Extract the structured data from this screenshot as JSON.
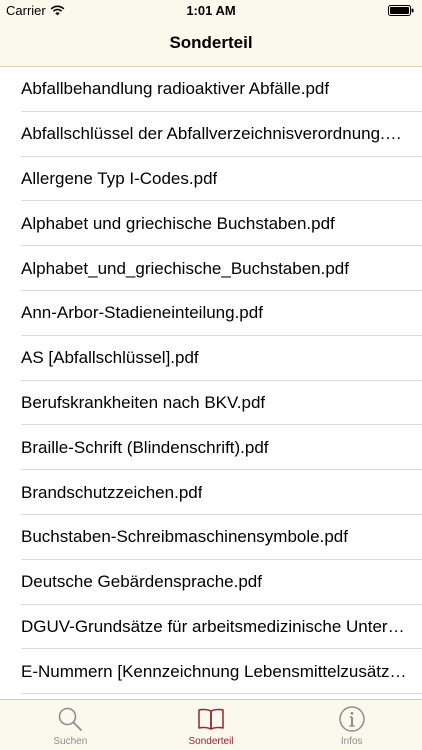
{
  "status_bar": {
    "carrier": "Carrier",
    "time": "1:01 AM"
  },
  "nav": {
    "title": "Sonderteil"
  },
  "list": {
    "items": [
      "Abfallbehandlung radioaktiver Abfälle.pdf",
      "Abfallschlüssel der Abfallverzeichnisverordnung.pdf",
      "Allergene Typ I-Codes.pdf",
      "Alphabet und griechische Buchstaben.pdf",
      "Alphabet_und_griechische_Buchstaben.pdf",
      "Ann-Arbor-Stadieneinteilung.pdf",
      "AS [Abfallschlüssel].pdf",
      "Berufskrankheiten nach BKV.pdf",
      "Braille-Schrift (Blindenschrift).pdf",
      "Brandschutzzeichen.pdf",
      "Buchstaben-Schreibmaschinensymbole.pdf",
      "Deutsche Gebärdensprache.pdf",
      "DGUV-Grundsätze für arbeitsmedizinische Untersuchungen.pdf",
      "E-Nummern [Kennzeichnung Lebensmittelzusätze].pdf"
    ]
  },
  "tabbar": {
    "tabs": [
      {
        "label": "Suchen",
        "icon": "search-icon",
        "active": false
      },
      {
        "label": "Sonderteil",
        "icon": "book-icon",
        "active": true
      },
      {
        "label": "Infos",
        "icon": "info-icon",
        "active": false
      }
    ]
  },
  "colors": {
    "bar_background": "#fbf8ec",
    "accent": "#9b2335",
    "inactive": "#8e8e93"
  }
}
